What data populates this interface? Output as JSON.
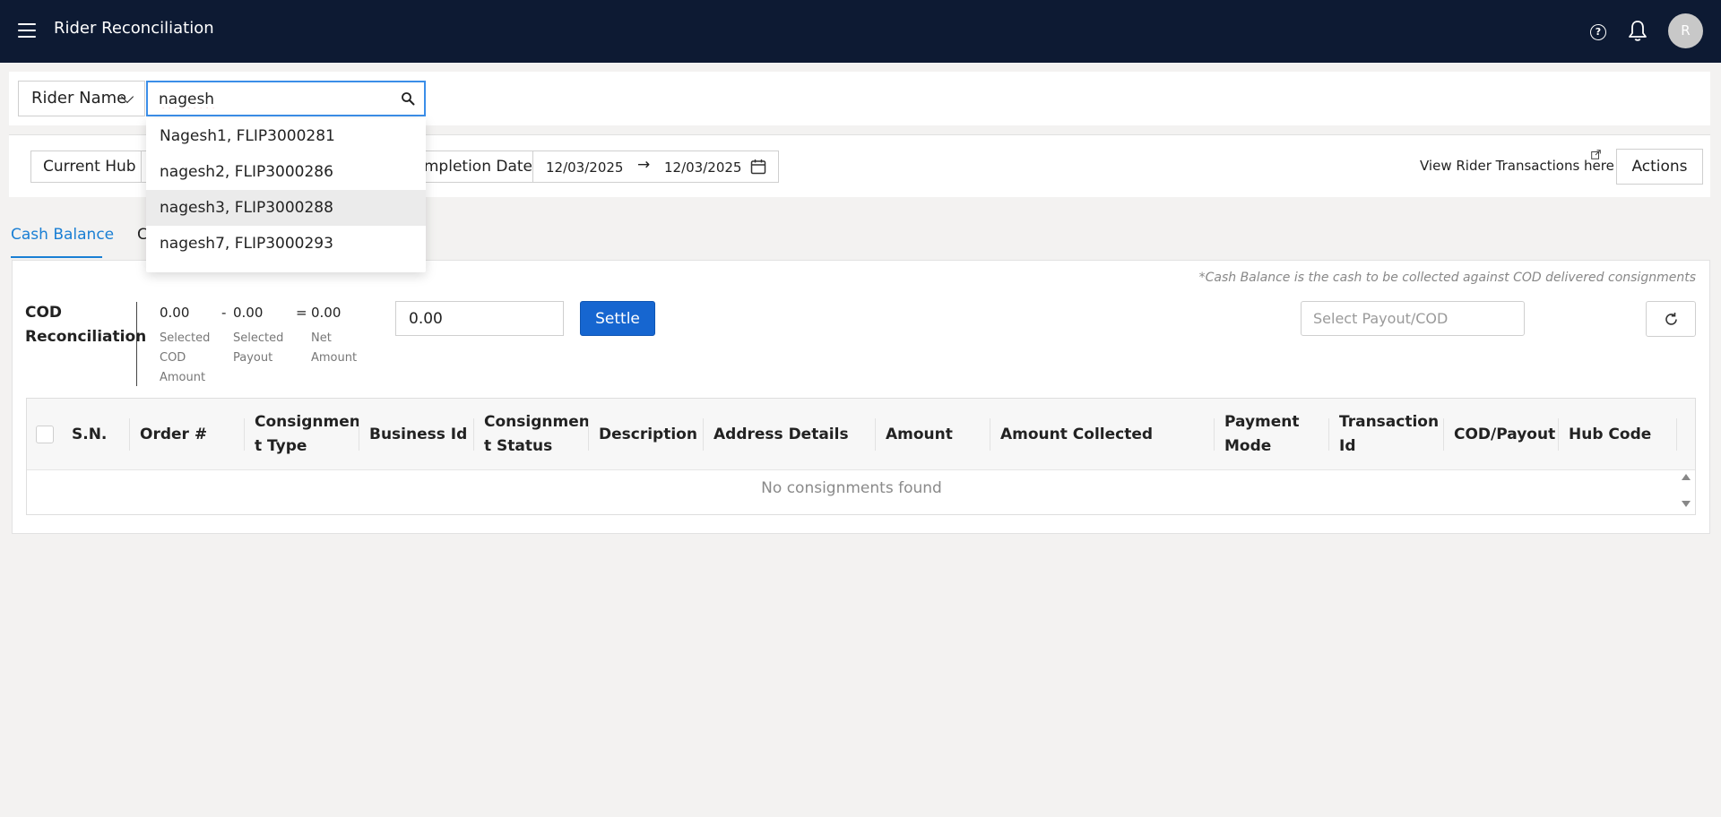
{
  "header": {
    "title": "Rider Reconciliation",
    "avatar_initial": "R",
    "bg_color": "#0d1a33"
  },
  "search": {
    "filter_label": "Rider Name",
    "query": "nagesh",
    "suggestions": [
      "Nagesh1, FLIP3000281",
      "nagesh2, FLIP3000286",
      "nagesh3, FLIP3000288",
      "nagesh7, FLIP3000293"
    ],
    "highlighted_index": 2
  },
  "filters": {
    "current_hub_label": "Current Hub",
    "completion_date_label": "Completion Date",
    "date_from": "12/03/2025",
    "date_to": "12/03/2025",
    "view_transactions": "View Rider Transactions here",
    "actions_label": "Actions"
  },
  "tabs": {
    "cash_balance": "Cash Balance",
    "second_partial": "C"
  },
  "cod": {
    "note": "*Cash Balance is the cash to be collected against COD delivered consignments",
    "title_line1": "COD",
    "title_line2": "Reconciliation",
    "selected_cod_value": "0.00",
    "selected_cod_label": [
      "Selected",
      "COD",
      "Amount"
    ],
    "minus": "-",
    "selected_payout_value": "0.00",
    "selected_payout_label": [
      "Selected",
      "Payout"
    ],
    "equals": "=",
    "net_amount_value": "0.00",
    "net_amount_label": [
      "Net",
      "Amount"
    ],
    "amount_input": "0.00",
    "settle_label": "Settle",
    "payout_placeholder": "Select Payout/COD",
    "accent_color": "#1666d0"
  },
  "table": {
    "columns": [
      "S.N.",
      "Order #",
      "Consignmen t Type",
      "Business Id",
      "Consignmen t Status",
      "Description",
      "Address Details",
      "Amount",
      "Amount Collected",
      "Payment Mode",
      "Transaction Id",
      "COD/Payout",
      "Hub Code"
    ],
    "columns_display": [
      [
        "S.N."
      ],
      [
        "Order #"
      ],
      [
        "Consignmen",
        "t Type"
      ],
      [
        "Business Id"
      ],
      [
        "Consignmen",
        "t Status"
      ],
      [
        "Description"
      ],
      [
        "Address Details"
      ],
      [
        "Amount"
      ],
      [
        "Amount Collected"
      ],
      [
        "Payment",
        "Mode"
      ],
      [
        "Transaction",
        "Id"
      ],
      [
        "COD/Payout"
      ],
      [
        "Hub Code"
      ]
    ],
    "empty_message": "No consignments found"
  }
}
